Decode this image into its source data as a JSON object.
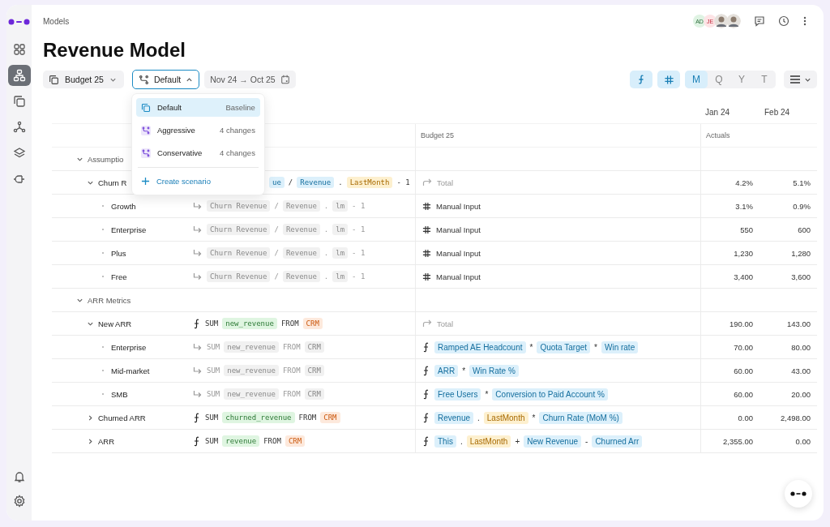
{
  "breadcrumb": "Models",
  "title": "Revenue Model",
  "avatars": [
    {
      "kind": "initials",
      "text": "AD",
      "color": "#dff3e3"
    },
    {
      "kind": "initials",
      "text": "JE",
      "color": "#fde4e6"
    },
    {
      "kind": "photo"
    },
    {
      "kind": "photo"
    }
  ],
  "sidebar": {
    "items": [
      {
        "kind": "grid",
        "selected": false
      },
      {
        "kind": "hierarchy",
        "selected": true
      },
      {
        "kind": "copy",
        "selected": false
      },
      {
        "kind": "nodes",
        "selected": false
      },
      {
        "kind": "layers",
        "selected": false
      },
      {
        "kind": "plug",
        "selected": false
      }
    ]
  },
  "toolbar": {
    "version": "Budget 25",
    "scenario": {
      "label": "Default",
      "expanded": true
    },
    "date_range": "Nov 24 → Oct 25",
    "toggles": [
      {
        "kind": "formula",
        "on": true
      },
      {
        "kind": "number",
        "on": true
      }
    ],
    "periods": [
      {
        "label": "M",
        "selected": true
      },
      {
        "label": "Q",
        "selected": false
      },
      {
        "label": "Y",
        "selected": false
      },
      {
        "label": "T",
        "selected": false
      }
    ]
  },
  "scenario_menu": {
    "items": [
      {
        "kind": "baseline",
        "label": "Default",
        "note": "Baseline",
        "selected": true
      },
      {
        "kind": "scenario",
        "label": "Aggressive",
        "note": "4 changes",
        "selected": false
      },
      {
        "kind": "scenario",
        "label": "Conservative",
        "note": "4 changes",
        "selected": false
      }
    ],
    "action": "Create scenario"
  },
  "table": {
    "month_headers": [
      "Jan 24",
      "Feb 24"
    ],
    "budget_header": "Budget 25",
    "actuals_header": "Actuals",
    "rows": [
      {
        "kind": "group",
        "name": "Assumptio",
        "expanded": true,
        "children": [
          {
            "kind": "metric",
            "name": "Churn R",
            "expanded": true,
            "formula": {
              "kind": "covered",
              "tokens": [
                {
                  "kind": "ref",
                  "text": "ue"
                },
                {
                  "kind": "op",
                  "text": "/"
                },
                {
                  "kind": "ref",
                  "text": "Revenue"
                },
                {
                  "kind": "op",
                  "text": "."
                },
                {
                  "kind": "prop",
                  "text": "LastMonth"
                },
                {
                  "kind": "op",
                  "text": "- 1"
                }
              ]
            },
            "budget": {
              "kind": "total",
              "text": "Total"
            },
            "values": [
              "4.2%",
              "5.1%"
            ],
            "children": [
              {
                "kind": "metric",
                "name": "Growth",
                "formula": {
                  "kind": "inherited",
                  "tokens": [
                    {
                      "kind": "ref",
                      "text": "Churn Revenue"
                    },
                    {
                      "kind": "op",
                      "text": "/"
                    },
                    {
                      "kind": "ref",
                      "text": "Revenue"
                    },
                    {
                      "kind": "op",
                      "text": "."
                    },
                    {
                      "kind": "prop",
                      "text": "lm"
                    },
                    {
                      "kind": "op",
                      "text": "- 1"
                    }
                  ]
                },
                "budget": {
                  "kind": "manual",
                  "text": "Manual Input"
                },
                "values": [
                  "3.1%",
                  "0.9%"
                ]
              },
              {
                "kind": "metric",
                "name": "Enterprise",
                "formula": {
                  "kind": "inherited",
                  "tokens": [
                    {
                      "kind": "ref",
                      "text": "Churn Revenue"
                    },
                    {
                      "kind": "op",
                      "text": "/"
                    },
                    {
                      "kind": "ref",
                      "text": "Revenue"
                    },
                    {
                      "kind": "op",
                      "text": "."
                    },
                    {
                      "kind": "prop",
                      "text": "lm"
                    },
                    {
                      "kind": "op",
                      "text": "- 1"
                    }
                  ]
                },
                "budget": {
                  "kind": "manual",
                  "text": "Manual Input"
                },
                "values": [
                  "550",
                  "600"
                ]
              },
              {
                "kind": "metric",
                "name": "Plus",
                "formula": {
                  "kind": "inherited",
                  "tokens": [
                    {
                      "kind": "ref",
                      "text": "Churn Revenue"
                    },
                    {
                      "kind": "op",
                      "text": "/"
                    },
                    {
                      "kind": "ref",
                      "text": "Revenue"
                    },
                    {
                      "kind": "op",
                      "text": "."
                    },
                    {
                      "kind": "prop",
                      "text": "lm"
                    },
                    {
                      "kind": "op",
                      "text": "- 1"
                    }
                  ]
                },
                "budget": {
                  "kind": "manual",
                  "text": "Manual Input"
                },
                "values": [
                  "1,230",
                  "1,280"
                ]
              },
              {
                "kind": "metric",
                "name": "Free",
                "formula": {
                  "kind": "inherited",
                  "tokens": [
                    {
                      "kind": "ref",
                      "text": "Churn Revenue"
                    },
                    {
                      "kind": "op",
                      "text": "/"
                    },
                    {
                      "kind": "ref",
                      "text": "Revenue"
                    },
                    {
                      "kind": "op",
                      "text": "."
                    },
                    {
                      "kind": "prop",
                      "text": "lm"
                    },
                    {
                      "kind": "op",
                      "text": "- 1"
                    }
                  ]
                },
                "budget": {
                  "kind": "manual",
                  "text": "Manual Input"
                },
                "values": [
                  "3,400",
                  "3,600"
                ]
              }
            ]
          }
        ]
      },
      {
        "kind": "group",
        "name": "ARR Metrics",
        "expanded": true,
        "children": [
          {
            "kind": "metric",
            "name": "New ARR",
            "expanded": true,
            "formula": {
              "kind": "formula",
              "tokens": [
                {
                  "kind": "kw",
                  "text": "SUM"
                },
                {
                  "kind": "col",
                  "text": "new_revenue"
                },
                {
                  "kind": "kw",
                  "text": "FROM"
                },
                {
                  "kind": "src",
                  "text": "CRM"
                }
              ]
            },
            "budget": {
              "kind": "total",
              "text": "Total"
            },
            "values": [
              "190.00",
              "143.00"
            ],
            "children": [
              {
                "kind": "metric",
                "name": "Enterprise",
                "formula": {
                  "kind": "inherited",
                  "tokens": [
                    {
                      "kind": "kw",
                      "text": "SUM"
                    },
                    {
                      "kind": "col",
                      "text": "new_revenue"
                    },
                    {
                      "kind": "kw",
                      "text": "FROM"
                    },
                    {
                      "kind": "src",
                      "text": "CRM"
                    }
                  ]
                },
                "budget": {
                  "kind": "formula",
                  "tokens": [
                    {
                      "kind": "ref",
                      "text": "Ramped AE Headcount"
                    },
                    {
                      "kind": "op",
                      "text": "*"
                    },
                    {
                      "kind": "ref",
                      "text": "Quota Target"
                    },
                    {
                      "kind": "op",
                      "text": "*"
                    },
                    {
                      "kind": "ref",
                      "text": "Win rate"
                    }
                  ]
                },
                "values": [
                  "70.00",
                  "80.00"
                ]
              },
              {
                "kind": "metric",
                "name": "Mid-market",
                "formula": {
                  "kind": "inherited",
                  "tokens": [
                    {
                      "kind": "kw",
                      "text": "SUM"
                    },
                    {
                      "kind": "col",
                      "text": "new_revenue"
                    },
                    {
                      "kind": "kw",
                      "text": "FROM"
                    },
                    {
                      "kind": "src",
                      "text": "CRM"
                    }
                  ]
                },
                "budget": {
                  "kind": "formula",
                  "tokens": [
                    {
                      "kind": "ref",
                      "text": "ARR"
                    },
                    {
                      "kind": "op",
                      "text": "*"
                    },
                    {
                      "kind": "ref",
                      "text": "Win Rate %"
                    }
                  ]
                },
                "values": [
                  "60.00",
                  "43.00"
                ]
              },
              {
                "kind": "metric",
                "name": "SMB",
                "formula": {
                  "kind": "inherited",
                  "tokens": [
                    {
                      "kind": "kw",
                      "text": "SUM"
                    },
                    {
                      "kind": "col",
                      "text": "new_revenue"
                    },
                    {
                      "kind": "kw",
                      "text": "FROM"
                    },
                    {
                      "kind": "src",
                      "text": "CRM"
                    }
                  ]
                },
                "budget": {
                  "kind": "formula",
                  "tokens": [
                    {
                      "kind": "ref",
                      "text": "Free Users"
                    },
                    {
                      "kind": "op",
                      "text": "*"
                    },
                    {
                      "kind": "ref",
                      "text": "Conversion to Paid Account %"
                    }
                  ]
                },
                "values": [
                  "60.00",
                  "20.00"
                ]
              }
            ]
          },
          {
            "kind": "metric",
            "name": "Churned ARR",
            "expanded": false,
            "formula": {
              "kind": "formula",
              "tokens": [
                {
                  "kind": "kw",
                  "text": "SUM"
                },
                {
                  "kind": "col",
                  "text": "churned_revenue"
                },
                {
                  "kind": "kw",
                  "text": "FROM"
                },
                {
                  "kind": "src",
                  "text": "CRM"
                }
              ]
            },
            "budget": {
              "kind": "formula",
              "tokens": [
                {
                  "kind": "ref",
                  "text": "Revenue"
                },
                {
                  "kind": "op",
                  "text": "."
                },
                {
                  "kind": "prop",
                  "text": "LastMonth"
                },
                {
                  "kind": "op",
                  "text": "*"
                },
                {
                  "kind": "ref",
                  "text": "Churn Rate (MoM %)"
                }
              ]
            },
            "values": [
              "0.00",
              "2,498.00"
            ]
          },
          {
            "kind": "metric",
            "name": "ARR",
            "expanded": false,
            "formula": {
              "kind": "formula",
              "tokens": [
                {
                  "kind": "kw",
                  "text": "SUM"
                },
                {
                  "kind": "col",
                  "text": "revenue"
                },
                {
                  "kind": "kw",
                  "text": "FROM"
                },
                {
                  "kind": "src",
                  "text": "CRM"
                }
              ]
            },
            "budget": {
              "kind": "formula",
              "tokens": [
                {
                  "kind": "ref",
                  "text": "This"
                },
                {
                  "kind": "op",
                  "text": "."
                },
                {
                  "kind": "prop",
                  "text": "LastMonth"
                },
                {
                  "kind": "op",
                  "text": "+"
                },
                {
                  "kind": "ref",
                  "text": "New Revenue"
                },
                {
                  "kind": "op",
                  "text": "-"
                },
                {
                  "kind": "ref",
                  "text": "Churned Arr"
                }
              ]
            },
            "values": [
              "2,355.00",
              "0.00"
            ]
          }
        ]
      }
    ]
  }
}
